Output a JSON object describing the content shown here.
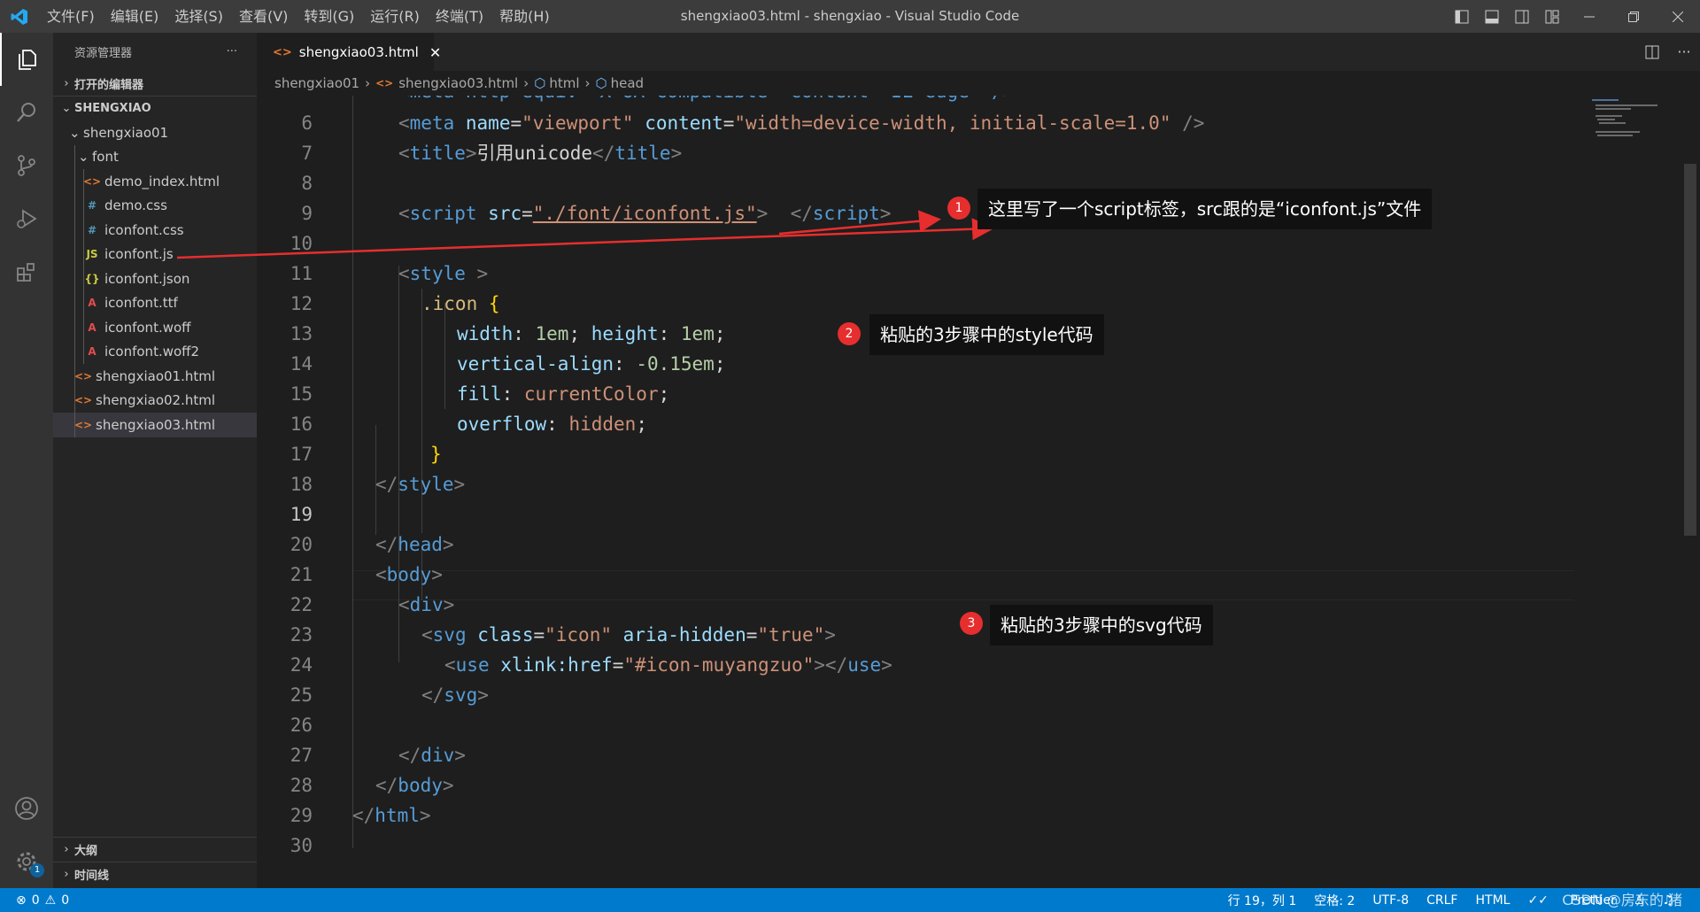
{
  "window": {
    "title": "shengxiao03.html - shengxiao - Visual Studio Code",
    "menu": [
      "文件(F)",
      "编辑(E)",
      "选择(S)",
      "查看(V)",
      "转到(G)",
      "运行(R)",
      "终端(T)",
      "帮助(H)"
    ]
  },
  "activity": {
    "settings_badge": "1"
  },
  "sidebar": {
    "header": "资源管理器",
    "more": "···",
    "open_editors": "打开的编辑器",
    "root": "SHENGXIAO",
    "folder": "shengxiao01",
    "subfolder": "font",
    "files": [
      {
        "name": "demo_index.html",
        "icon": "<>",
        "color": "#e37933"
      },
      {
        "name": "demo.css",
        "icon": "#",
        "color": "#519aba"
      },
      {
        "name": "iconfont.css",
        "icon": "#",
        "color": "#519aba"
      },
      {
        "name": "iconfont.js",
        "icon": "JS",
        "color": "#cbcb41"
      },
      {
        "name": "iconfont.json",
        "icon": "{}",
        "color": "#cbcb41"
      },
      {
        "name": "iconfont.ttf",
        "icon": "A",
        "color": "#e34c4c"
      },
      {
        "name": "iconfont.woff",
        "icon": "A",
        "color": "#e34c4c"
      },
      {
        "name": "iconfont.woff2",
        "icon": "A",
        "color": "#e34c4c"
      }
    ],
    "html_files": [
      {
        "name": "shengxiao01.html",
        "icon": "<>",
        "color": "#e37933"
      },
      {
        "name": "shengxiao02.html",
        "icon": "<>",
        "color": "#e37933"
      },
      {
        "name": "shengxiao03.html",
        "icon": "<>",
        "color": "#e37933"
      }
    ],
    "outline": "大纲",
    "timeline": "时间线"
  },
  "editor": {
    "tab": "shengxiao03.html",
    "breadcrumb": [
      "shengxiao01",
      "shengxiao03.html",
      "html",
      "head"
    ],
    "line_numbers": [
      "6",
      "7",
      "8",
      "9",
      "10",
      "11",
      "12",
      "13",
      "14",
      "15",
      "16",
      "17",
      "18",
      "19",
      "20",
      "21",
      "22",
      "23",
      "24",
      "25",
      "26",
      "27",
      "28",
      "29",
      "30"
    ],
    "current_line": "19",
    "code_top": "<meta http-equiv=\"X-UA-Compatible\" content=\"IE=edge\" />",
    "code": {
      "l6_tag": "meta",
      "l6_a1": "name",
      "l6_v1": "\"viewport\"",
      "l6_a2": "content",
      "l6_v2": "\"width=device-width, initial-scale=1.0\"",
      "l7_tag": "title",
      "l7_text": "引用unicode",
      "l9_tag": "script",
      "l9_a1": "src",
      "l9_v1": "\"./font/iconfont.js\"",
      "l11_tag": "style",
      "l12_sel": ".icon",
      "l13_p1": "width",
      "l13_v1": "1em",
      "l13_p2": "height",
      "l13_v2": "1em",
      "l14_p": "vertical-align",
      "l14_v": "-0.15em",
      "l15_p": "fill",
      "l15_v": "currentColor",
      "l16_p": "overflow",
      "l16_v": "hidden",
      "l20_tag": "head",
      "l21_tag": "body",
      "l22_tag": "div",
      "l23_tag": "svg",
      "l23_a1": "class",
      "l23_v1": "\"icon\"",
      "l23_a2": "aria-hidden",
      "l23_v2": "\"true\"",
      "l24_tag": "use",
      "l24_a1": "xlink:href",
      "l24_v1": "\"#icon-muyangzuo\"",
      "l29_tag": "html"
    }
  },
  "annotations": [
    {
      "num": "1",
      "text": "这里写了一个script标签，src跟的是“iconfont.js”文件"
    },
    {
      "num": "2",
      "text": "粘贴的3步骤中的style代码"
    },
    {
      "num": "3",
      "text": "粘贴的3步骤中的svg代码"
    }
  ],
  "status": {
    "errors": "0",
    "warnings": "0",
    "position": "行 19，列 1",
    "spaces": "空格: 2",
    "encoding": "UTF-8",
    "eol": "CRLF",
    "language": "HTML",
    "formatter": "Prettier",
    "watermark": "CSDN @房东的 猪"
  },
  "colors": {
    "statusbar": "#007acc",
    "accent_red": "#e62e2e",
    "activity": "#333333",
    "sidebar": "#252526",
    "editor": "#1e1e1e"
  }
}
